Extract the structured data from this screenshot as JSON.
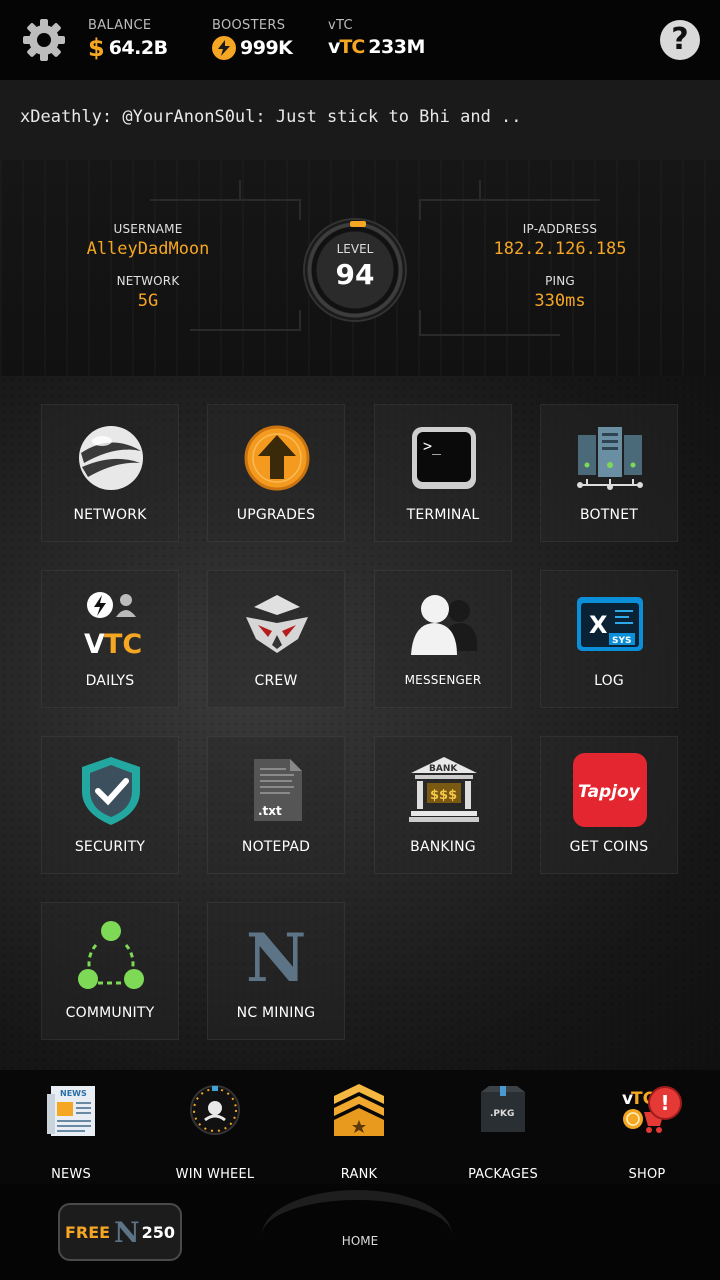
{
  "topbar": {
    "balance_label": "BALANCE",
    "balance_value": "64.2B",
    "boosters_label": "BOOSTERS",
    "boosters_value": "999K",
    "vtc_label": "vTC",
    "vtc_value": "233M",
    "vtc_mark_v": "v",
    "vtc_mark_tc": "TC",
    "help_glyph": "?"
  },
  "chat": {
    "text": "xDeathly: @YourAnonS0ul: Just stick to Bhi and .."
  },
  "profile": {
    "username_label": "USERNAME",
    "username": "AlleyDadMoon",
    "network_label": "NETWORK",
    "network": "5G",
    "level_label": "LEVEL",
    "level": "94",
    "ip_label": "IP-ADDRESS",
    "ip": "182.2.126.185",
    "ping_label": "PING",
    "ping": "330ms"
  },
  "apps": [
    {
      "label": "NETWORK",
      "icon": "globe-icon"
    },
    {
      "label": "UPGRADES",
      "icon": "upgrade-arrow-icon"
    },
    {
      "label": "TERMINAL",
      "icon": "terminal-icon"
    },
    {
      "label": "BOTNET",
      "icon": "server-rack-icon"
    },
    {
      "label": "DAILYS",
      "icon": "dailys-vtc-icon"
    },
    {
      "label": "CREW",
      "icon": "crew-mask-icon"
    },
    {
      "label": "MESSENGER",
      "icon": "messenger-users-icon"
    },
    {
      "label": "LOG",
      "icon": "log-sys-icon"
    },
    {
      "label": "SECURITY",
      "icon": "shield-check-icon"
    },
    {
      "label": "NOTEPAD",
      "icon": "notepad-txt-icon"
    },
    {
      "label": "BANKING",
      "icon": "bank-icon"
    },
    {
      "label": "GET COINS",
      "icon": "tapjoy-icon"
    },
    {
      "label": "COMMUNITY",
      "icon": "community-icon"
    },
    {
      "label": "NC MINING",
      "icon": "nc-mining-icon"
    }
  ],
  "app_icon_text": {
    "terminal_prompt": ">_",
    "log_x": "X",
    "log_sys": "SYS",
    "notepad_ext": ".txt",
    "bank_word": "BANK",
    "bank_money": "$$$",
    "tapjoy": "Tapjoy",
    "nc_letter": "N",
    "dailys_v": "V",
    "dailys_tc": "TC"
  },
  "bottom_nav": [
    {
      "label": "NEWS",
      "icon": "newspaper-icon"
    },
    {
      "label": "WIN WHEEL",
      "icon": "win-wheel-icon"
    },
    {
      "label": "RANK",
      "icon": "rank-chevrons-icon"
    },
    {
      "label": "PACKAGES",
      "icon": "pkg-box-icon"
    },
    {
      "label": "SHOP",
      "icon": "shop-cart-icon"
    }
  ],
  "bottom_icon_text": {
    "news_word": "NEWS",
    "pkg_word": ".PKG",
    "shop_vtc_v": "v",
    "shop_vtc_tc": "TC",
    "shop_alert": "!"
  },
  "footer": {
    "free_label": "FREE",
    "free_letter": "N",
    "free_amount": "250",
    "home_label": "HOME"
  },
  "colors": {
    "accent": "#f5a623",
    "background": "#0c0c0c"
  }
}
